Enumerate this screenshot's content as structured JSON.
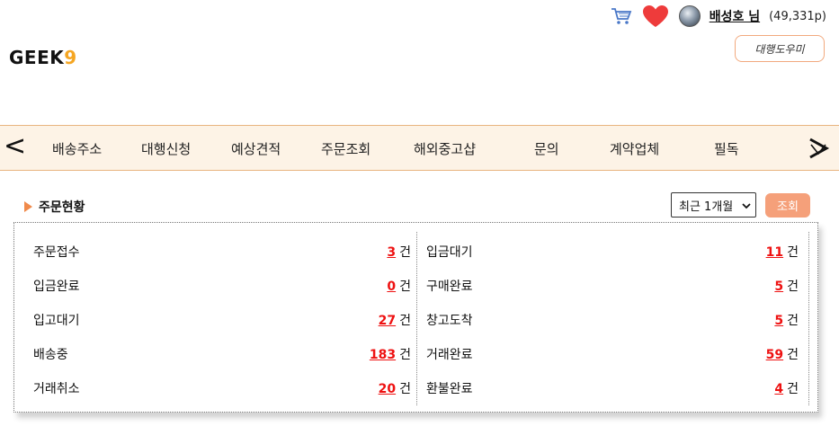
{
  "header": {
    "logo_main": "GEEK",
    "logo_accent": "9",
    "user_name": "배성호 님",
    "user_points": "(49,331p)",
    "help_button": "대행도우미"
  },
  "nav": {
    "prev": "<",
    "items": [
      "배송주소",
      "대행신청",
      "예상견적",
      "주문조회",
      "해외중고샵",
      "문의",
      "계약업체",
      "필독"
    ]
  },
  "order_status": {
    "title": "주문현황",
    "period_selected": "최근 1개월",
    "search_button": "조회",
    "unit": "건",
    "left": [
      {
        "label": "주문접수",
        "count": "3"
      },
      {
        "label": "입금완료",
        "count": "0"
      },
      {
        "label": "입고대기",
        "count": "27"
      },
      {
        "label": "배송중",
        "count": "183"
      },
      {
        "label": "거래취소",
        "count": "20"
      }
    ],
    "right": [
      {
        "label": "입금대기",
        "count": "11"
      },
      {
        "label": "구매완료",
        "count": "5"
      },
      {
        "label": "창고도착",
        "count": "5"
      },
      {
        "label": "거래완료",
        "count": "59"
      },
      {
        "label": "환불완료",
        "count": "4"
      }
    ]
  },
  "icons": {
    "cart": "cart-icon",
    "heart": "heart-icon",
    "avatar": "avatar",
    "next": "next-arrow-icon"
  },
  "colors": {
    "accent_orange": "#f08a4b",
    "count_red": "#e11111",
    "nav_bg": "#fdf3e6",
    "button_bg": "#f5a07a",
    "heart": "#ee3b3b",
    "logo_accent": "#f5a623"
  }
}
